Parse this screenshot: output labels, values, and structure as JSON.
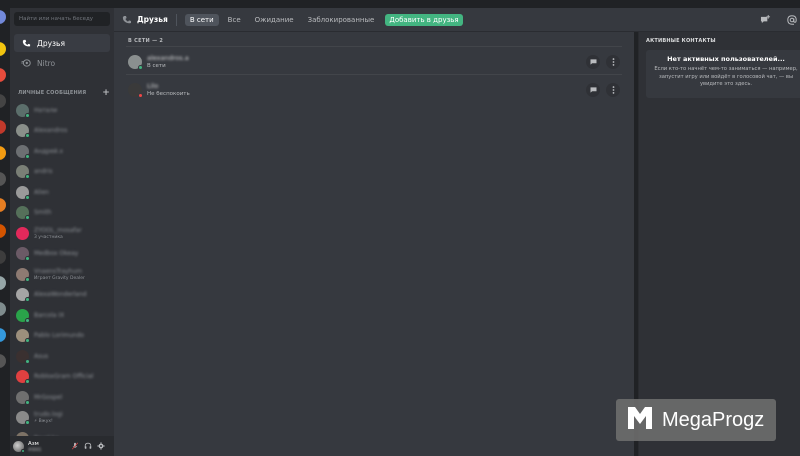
{
  "window": {
    "title": "Discord"
  },
  "sidebar": {
    "search_placeholder": "Найти или начать беседу",
    "nav": [
      {
        "label": "Друзья",
        "icon": "friends-icon",
        "active": true
      },
      {
        "label": "Nitro",
        "icon": "nitro-icon",
        "active": false
      }
    ],
    "dm_section_title": "ЛИЧНЫЕ СООБЩЕНИЯ",
    "dm_add_label": "+",
    "dms": [
      {
        "name": "Натали",
        "sub": "",
        "color": "#5b6e6b",
        "status": "online"
      },
      {
        "name": "Alexandros",
        "sub": "",
        "color": "#8a8f8a",
        "status": "online"
      },
      {
        "name": "Андрей.x",
        "sub": "",
        "color": "#6c6f72",
        "status": "online"
      },
      {
        "name": "andris",
        "sub": "",
        "color": "#7a7f76",
        "status": "online"
      },
      {
        "name": "Alien",
        "sub": "",
        "color": "#9a9a9a",
        "status": "online"
      },
      {
        "name": "Smith",
        "sub": "",
        "color": "#55705a",
        "status": "online"
      },
      {
        "name": "ZYOOL_mosafar",
        "sub": "3 участника",
        "color": "#e2295b",
        "status": "none"
      },
      {
        "name": "Medbox Okeay",
        "sub": "",
        "color": "#6b5a66",
        "status": "online"
      },
      {
        "name": "VnaensTrayhum",
        "sub": "Играет Gravity Dealer",
        "color": "#8d7a72",
        "status": "online"
      },
      {
        "name": "AlexaWonderland",
        "sub": "",
        "color": "#a5a5a5",
        "status": "online"
      },
      {
        "name": "Barcola IX",
        "sub": "",
        "color": "#2aa34a",
        "status": "online"
      },
      {
        "name": "Pablo Lorimundo",
        "sub": "",
        "color": "#9c8f7c",
        "status": "online"
      },
      {
        "name": "Asus",
        "sub": "",
        "color": "#3a3030",
        "status": "online"
      },
      {
        "name": "RobloxGram Official",
        "sub": "",
        "color": "#e04040",
        "status": "online"
      },
      {
        "name": "MrGospel",
        "sub": "",
        "color": "#6f6f6f",
        "status": "online"
      },
      {
        "name": "trudo.logi",
        "sub": "⚡ Вжух!",
        "color": "#8a8a8a",
        "status": "online"
      },
      {
        "name": "Pavel.ka",
        "sub": "",
        "color": "#7d7266",
        "status": "online"
      },
      {
        "name": "mosaika",
        "sub": "",
        "color": "#a08c6c",
        "status": "online"
      }
    ]
  },
  "user_panel": {
    "name": "Азм",
    "tag": "#0001"
  },
  "header": {
    "title": "Друзья",
    "tabs": [
      {
        "label": "В сети",
        "active": true
      },
      {
        "label": "Все",
        "active": false
      },
      {
        "label": "Ожидание",
        "active": false
      },
      {
        "label": "Заблокированные",
        "active": false
      }
    ],
    "add_friend_label": "Добавить в друзья"
  },
  "main": {
    "section_title": "В СЕТИ — 2",
    "friends": [
      {
        "name": "alexandros.a",
        "status_text": "В сети",
        "status": "online",
        "color": "#8a8f8f"
      },
      {
        "name": "Lilo",
        "status_text": "Не беспокоить",
        "status": "dnd",
        "color": "#3a3a3a"
      }
    ]
  },
  "active_contacts": {
    "title": "АКТИВНЫЕ КОНТАКТЫ",
    "card_title": "Нет активных пользователей...",
    "card_desc": "Если кто-то начнёт чем-то заниматься — например, запустит игру или войдёт в голосовой чат, — вы увидите это здесь."
  },
  "watermark": {
    "text": "MegaProgz"
  },
  "colors": {
    "accent_green": "#43b581",
    "dnd_red": "#f04747"
  }
}
